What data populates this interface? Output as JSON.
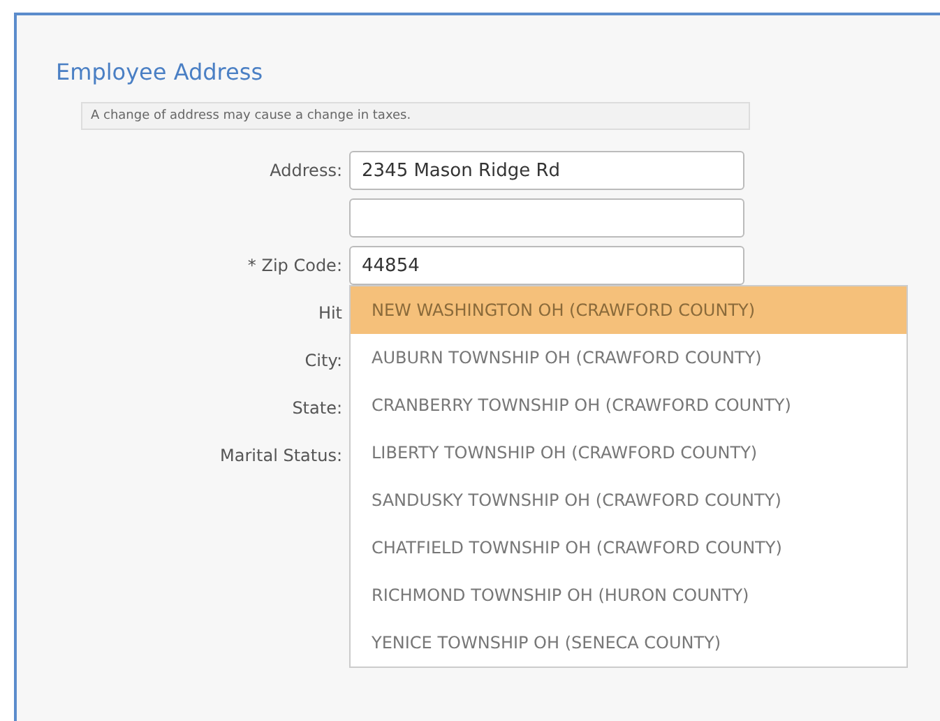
{
  "section": {
    "title": "Employee Address",
    "notice": "A change of address may cause a change in taxes."
  },
  "fields": [
    {
      "kind": "input",
      "label": "Address:",
      "value": "2345 Mason Ridge Rd"
    },
    {
      "kind": "input"
    },
    {
      "kind": "input",
      "label": "* Zip Code:",
      "value": "44854",
      "suggestions": [
        {
          "text": "NEW WASHINGTON OH (CRAWFORD COUNTY)",
          "selected": true
        },
        {
          "text": "AUBURN TOWNSHIP OH (CRAWFORD COUNTY)",
          "selected": false
        },
        {
          "text": "CRANBERRY TOWNSHIP OH (CRAWFORD COUNTY)",
          "selected": false
        },
        {
          "text": "LIBERTY TOWNSHIP OH (CRAWFORD COUNTY)",
          "selected": false
        },
        {
          "text": "SANDUSKY TOWNSHIP OH (CRAWFORD COUNTY)",
          "selected": false
        },
        {
          "text": "CHATFIELD TOWNSHIP OH (CRAWFORD COUNTY)",
          "selected": false
        },
        {
          "text": "RICHMOND TOWNSHIP OH (HURON COUNTY)",
          "selected": false
        },
        {
          "text": "YENICE TOWNSHIP OH (SENECA COUNTY)",
          "selected": false
        }
      ]
    },
    {
      "kind": "label",
      "label": "Hit"
    },
    {
      "kind": "label",
      "label": "City:"
    },
    {
      "kind": "label",
      "label": "State:"
    },
    {
      "kind": "label",
      "label": "Marital Status:"
    }
  ]
}
